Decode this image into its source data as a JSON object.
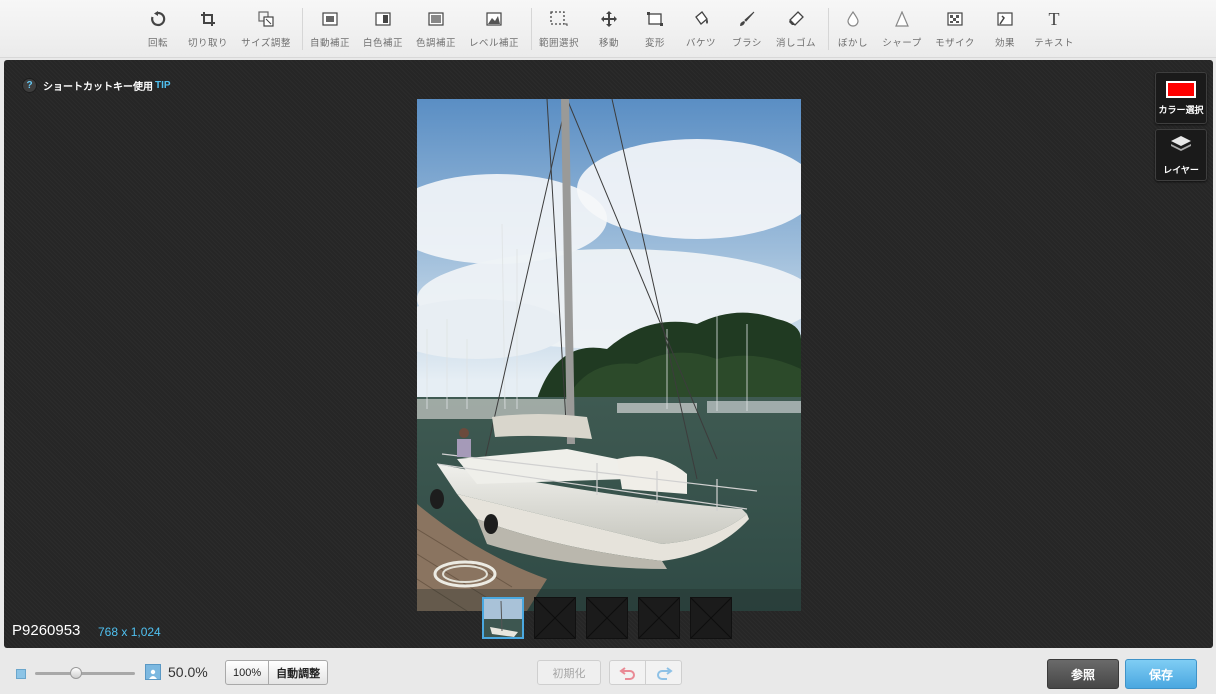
{
  "toolbar": {
    "tools": [
      {
        "id": "rotate",
        "label": "回転",
        "icon": "rotate-icon"
      },
      {
        "id": "crop",
        "label": "切り取り",
        "icon": "crop-icon"
      },
      {
        "id": "resize",
        "label": "サイズ調整",
        "icon": "resize-icon"
      },
      {
        "id": "auto-correct",
        "label": "自動補正",
        "icon": "auto-correct-icon"
      },
      {
        "id": "white-balance",
        "label": "白色補正",
        "icon": "white-balance-icon"
      },
      {
        "id": "color-tone",
        "label": "色調補正",
        "icon": "color-tone-icon"
      },
      {
        "id": "level",
        "label": "レベル補正",
        "icon": "level-icon"
      },
      {
        "id": "select",
        "label": "範囲選択",
        "icon": "marquee-select-icon"
      },
      {
        "id": "move",
        "label": "移動",
        "icon": "move-icon"
      },
      {
        "id": "transform",
        "label": "変形",
        "icon": "transform-icon"
      },
      {
        "id": "bucket",
        "label": "バケツ",
        "icon": "bucket-icon"
      },
      {
        "id": "brush",
        "label": "ブラシ",
        "icon": "brush-icon"
      },
      {
        "id": "eraser",
        "label": "消しゴム",
        "icon": "eraser-icon"
      },
      {
        "id": "blur",
        "label": "ぼかし",
        "icon": "blur-drop-icon"
      },
      {
        "id": "sharpen",
        "label": "シャープ",
        "icon": "sharpen-icon"
      },
      {
        "id": "mosaic",
        "label": "モザイク",
        "icon": "mosaic-icon"
      },
      {
        "id": "effect",
        "label": "効果",
        "icon": "effect-icon"
      },
      {
        "id": "text",
        "label": "テキスト",
        "icon": "text-icon"
      }
    ]
  },
  "tip": {
    "text": "ショートカットキー使用",
    "link": "TIP"
  },
  "side": {
    "color_label": "カラー選択",
    "color_value": "#ff0000",
    "layer_label": "レイヤー"
  },
  "file": {
    "name": "P9260953",
    "size": "768 x 1,024"
  },
  "zoom": {
    "value_text": "50.0%",
    "fraction": 0.5
  },
  "buttons": {
    "hundred": "100%",
    "auto_fit": "自動調整",
    "reset": "初期化",
    "browse": "参照",
    "save": "保存"
  },
  "colors": {
    "accent": "#4fc0f0",
    "save": "#4aa7e0",
    "canvas": "#262626"
  }
}
